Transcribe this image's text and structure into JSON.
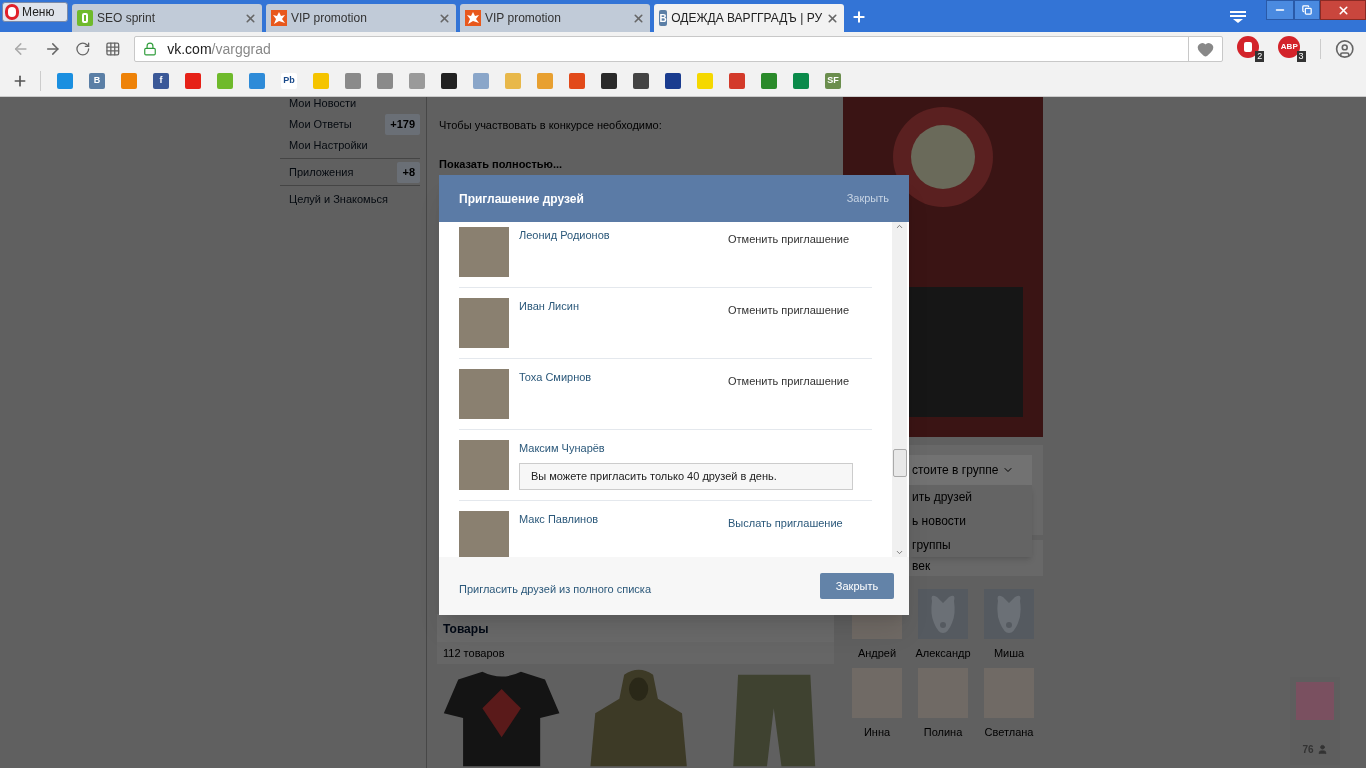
{
  "browser": {
    "menu_label": "Меню",
    "tabs": [
      {
        "title": "SEO sprint",
        "kind": "sprint",
        "selected": false
      },
      {
        "title": "VIP promotion",
        "kind": "burst",
        "selected": false
      },
      {
        "title": "VIP promotion",
        "kind": "burst",
        "selected": false
      },
      {
        "title": "ОДЕЖДА ВАРГГРАДЪ | РУ",
        "kind": "letter",
        "icon_label": "В",
        "selected": true
      }
    ],
    "address": {
      "host": "vk.com",
      "path": "/varggrad"
    },
    "extensions": [
      {
        "kind": "block",
        "badge": "2"
      },
      {
        "kind": "abp",
        "label": "ABP",
        "badge": "3"
      }
    ],
    "bookmarks": [
      {
        "color": "#1a8fe0"
      },
      {
        "color": "#5b7fa6",
        "label": "В"
      },
      {
        "color": "#ee8208"
      },
      {
        "color": "#3b5998",
        "label": "f"
      },
      {
        "color": "#e62117"
      },
      {
        "color": "#6fba2c"
      },
      {
        "color": "#2e8bd8"
      },
      {
        "color": "#ffffff",
        "label": "Pb"
      },
      {
        "color": "#f5c400"
      },
      {
        "color": "#8a8a8a"
      },
      {
        "color": "#8a8a8a"
      },
      {
        "color": "#9a9a9a"
      },
      {
        "color": "#222222"
      },
      {
        "color": "#8aa6c9"
      },
      {
        "color": "#e8b84a"
      },
      {
        "color": "#e8a030"
      },
      {
        "color": "#e24a1a"
      },
      {
        "color": "#2a2a2a"
      },
      {
        "color": "#444444"
      },
      {
        "color": "#1a3c8f"
      },
      {
        "color": "#f5d800"
      },
      {
        "color": "#d33a2a"
      },
      {
        "color": "#2a8a2a"
      },
      {
        "color": "#0a8a4a"
      },
      {
        "color": "#6b8e4e",
        "label": "SF"
      }
    ]
  },
  "sidebar": {
    "groups": [
      [
        {
          "label": "Мои Новости"
        },
        {
          "label": "Мои Ответы",
          "badge": "+179"
        },
        {
          "label": "Мои Настройки"
        }
      ],
      [
        {
          "label": "Приложения",
          "badge": "+8"
        }
      ],
      [
        {
          "label": "Целуй и Знакомься"
        }
      ]
    ]
  },
  "post": {
    "text": "Чтобы участвовать в конкурсе необходимо:",
    "more": "Показать полностью..."
  },
  "market": {
    "title": "Товары",
    "count": "112 товаров",
    "items": [
      {
        "kind": "tshirt"
      },
      {
        "kind": "hoodie"
      },
      {
        "kind": "pants"
      }
    ]
  },
  "group_menu": {
    "button": "стоите в группе",
    "items": [
      "ить друзей",
      "ь новости",
      "группы"
    ]
  },
  "members": {
    "title": "век",
    "people": [
      {
        "name": "Андрей",
        "kind": "photo"
      },
      {
        "name": "Александр",
        "kind": "default"
      },
      {
        "name": "Миша",
        "kind": "default"
      },
      {
        "name": "Инна",
        "kind": "photo"
      },
      {
        "name": "Полина",
        "kind": "photo"
      },
      {
        "name": "Светлана",
        "kind": "photo"
      }
    ]
  },
  "dialog": {
    "title": "Приглашение друзей",
    "close_link": "Закрыть",
    "rows": [
      {
        "name": "Леонид Родионов",
        "kind": "action",
        "action": "Отменить приглашение",
        "invited": true
      },
      {
        "name": "Иван Лисин",
        "kind": "action",
        "action": "Отменить приглашение",
        "invited": true
      },
      {
        "name": "Тоха Смирнов",
        "kind": "action",
        "action": "Отменить приглашение",
        "invited": true
      },
      {
        "name": "Максим Чунарёв",
        "kind": "notice",
        "notice": "Вы можете пригласить только 40 друзей в день."
      },
      {
        "name": "Макс Павлинов",
        "kind": "action",
        "action": "Выслать приглашение",
        "invited": false
      }
    ],
    "footer_link": "Пригласить друзей из полного списка",
    "close_button": "Закрыть"
  },
  "online_widget": {
    "count": "76"
  }
}
